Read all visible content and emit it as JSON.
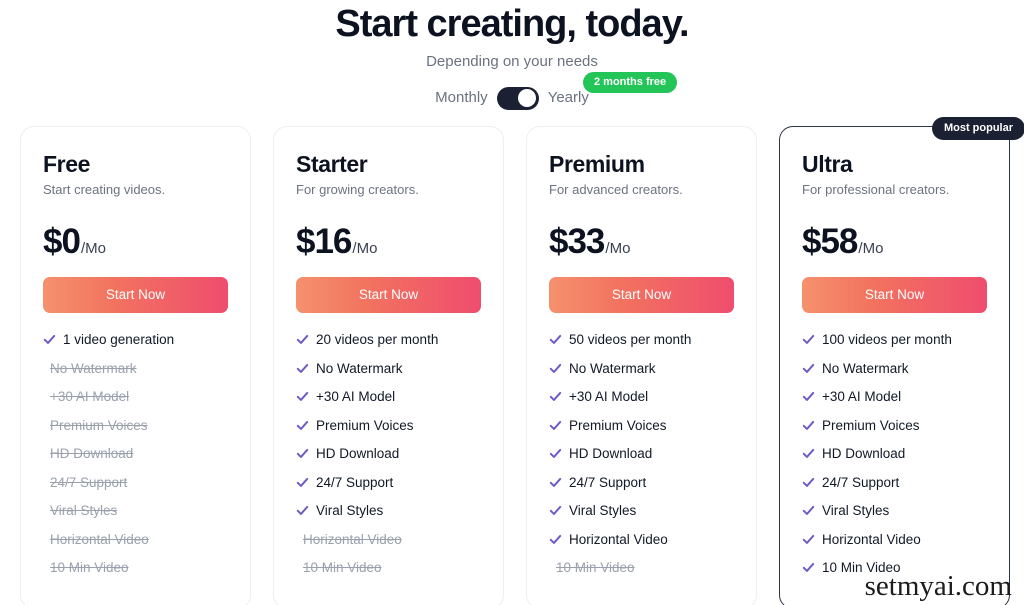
{
  "header": {
    "title": "Start creating, today.",
    "subtitle": "Depending on your needs"
  },
  "billing": {
    "monthly_label": "Monthly",
    "yearly_label": "Yearly",
    "promo_badge": "2 months free",
    "selected": "Yearly",
    "toggle_on": true,
    "promo_color": "#24c558",
    "toggle_color": "#1b2133"
  },
  "popular_badge": {
    "label": "Most popular",
    "plan": "Ultra",
    "background": "#1b2133"
  },
  "cta_gradient": {
    "from": "#f5916d",
    "to": "#ef4d6e"
  },
  "check_color": "#6d5ac4",
  "plans": [
    {
      "name": "Free",
      "tagline": "Start creating videos.",
      "price": "$0",
      "period": "/Mo",
      "cta": "Start Now",
      "featured": false,
      "features": [
        {
          "label": "1 video generation",
          "included": true
        },
        {
          "label": "No Watermark",
          "included": false
        },
        {
          "label": "+30 AI Model",
          "included": false
        },
        {
          "label": "Premium Voices",
          "included": false
        },
        {
          "label": "HD Download",
          "included": false
        },
        {
          "label": "24/7 Support",
          "included": false
        },
        {
          "label": "Viral Styles",
          "included": false
        },
        {
          "label": "Horizontal Video",
          "included": false
        },
        {
          "label": "10 Min Video",
          "included": false
        }
      ]
    },
    {
      "name": "Starter",
      "tagline": "For growing creators.",
      "price": "$16",
      "period": "/Mo",
      "cta": "Start Now",
      "featured": false,
      "features": [
        {
          "label": "20 videos per month",
          "included": true
        },
        {
          "label": "No Watermark",
          "included": true
        },
        {
          "label": "+30 AI Model",
          "included": true
        },
        {
          "label": "Premium Voices",
          "included": true
        },
        {
          "label": "HD Download",
          "included": true
        },
        {
          "label": "24/7 Support",
          "included": true
        },
        {
          "label": "Viral Styles",
          "included": true
        },
        {
          "label": "Horizontal Video",
          "included": false
        },
        {
          "label": "10 Min Video",
          "included": false
        }
      ]
    },
    {
      "name": "Premium",
      "tagline": "For advanced creators.",
      "price": "$33",
      "period": "/Mo",
      "cta": "Start Now",
      "featured": false,
      "features": [
        {
          "label": "50 videos per month",
          "included": true
        },
        {
          "label": "No Watermark",
          "included": true
        },
        {
          "label": "+30 AI Model",
          "included": true
        },
        {
          "label": "Premium Voices",
          "included": true
        },
        {
          "label": "HD Download",
          "included": true
        },
        {
          "label": "24/7 Support",
          "included": true
        },
        {
          "label": "Viral Styles",
          "included": true
        },
        {
          "label": "Horizontal Video",
          "included": true
        },
        {
          "label": "10 Min Video",
          "included": false
        }
      ]
    },
    {
      "name": "Ultra",
      "tagline": "For professional creators.",
      "price": "$58",
      "period": "/Mo",
      "cta": "Start Now",
      "featured": true,
      "features": [
        {
          "label": "100 videos per month",
          "included": true
        },
        {
          "label": "No Watermark",
          "included": true
        },
        {
          "label": "+30 AI Model",
          "included": true
        },
        {
          "label": "Premium Voices",
          "included": true
        },
        {
          "label": "HD Download",
          "included": true
        },
        {
          "label": "24/7 Support",
          "included": true
        },
        {
          "label": "Viral Styles",
          "included": true
        },
        {
          "label": "Horizontal Video",
          "included": true
        },
        {
          "label": "10 Min Video",
          "included": true
        }
      ]
    }
  ],
  "watermark": "setmyai.com"
}
